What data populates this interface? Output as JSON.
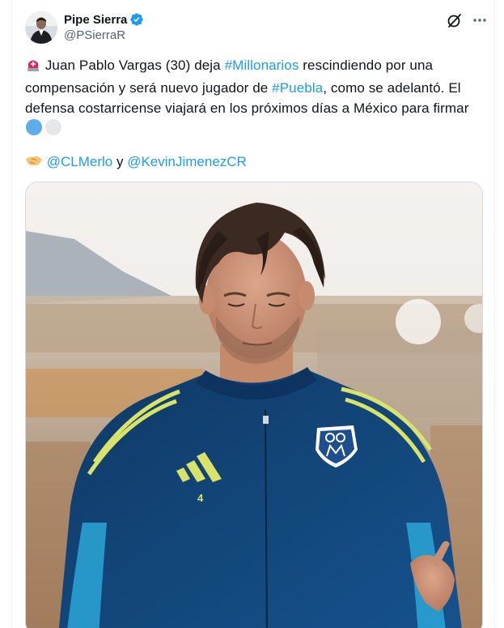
{
  "author": {
    "display_name": "Pipe Sierra",
    "handle": "@PSierraR"
  },
  "icons": {
    "verified": "verified-badge-icon",
    "grok": "grok-icon",
    "more": "more-options-icon",
    "siren": "rotating-light-emoji",
    "circle_blue": "blue-circle-emoji",
    "circle_white": "white-circle-emoji",
    "handshake": "handshake-emoji"
  },
  "tweet": {
    "part1": " Juan Pablo Vargas (30) deja ",
    "hashtag1": "#Millonarios",
    "part2": " rescindiendo por una compensación y será nuevo jugador de ",
    "hashtag2": "#Puebla",
    "part3": ", como se adelantó. El defensa costarricense viajará en los próximos días a México para firmar ",
    "mention1": "@CLMerlo",
    "connector": " y ",
    "mention2": "@KevinJimenezCR"
  },
  "media": {
    "jersey_number": "4"
  },
  "colors": {
    "link": "#1d9bf0",
    "verified": "#1d9bf0",
    "secondary_text": "#536471",
    "jersey": "#123f6e"
  }
}
